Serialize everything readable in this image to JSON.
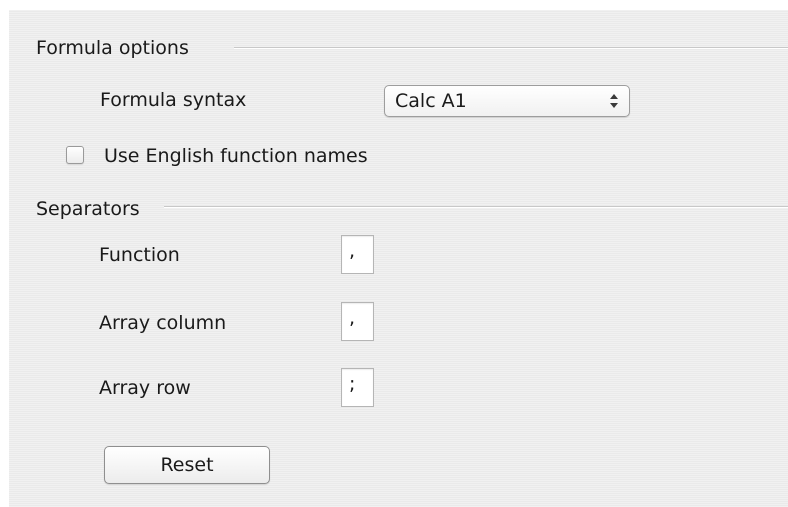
{
  "formula_options": {
    "section_title": "Formula options",
    "syntax_label": "Formula syntax",
    "syntax_value": "Calc A1",
    "english_names_label": "Use English function names",
    "english_names_checked": false
  },
  "separators": {
    "section_title": "Separators",
    "function_label": "Function",
    "function_value": ",",
    "array_column_label": "Array column",
    "array_column_value": ",",
    "array_row_label": "Array row",
    "array_row_value": ";"
  },
  "actions": {
    "reset_label": "Reset"
  }
}
